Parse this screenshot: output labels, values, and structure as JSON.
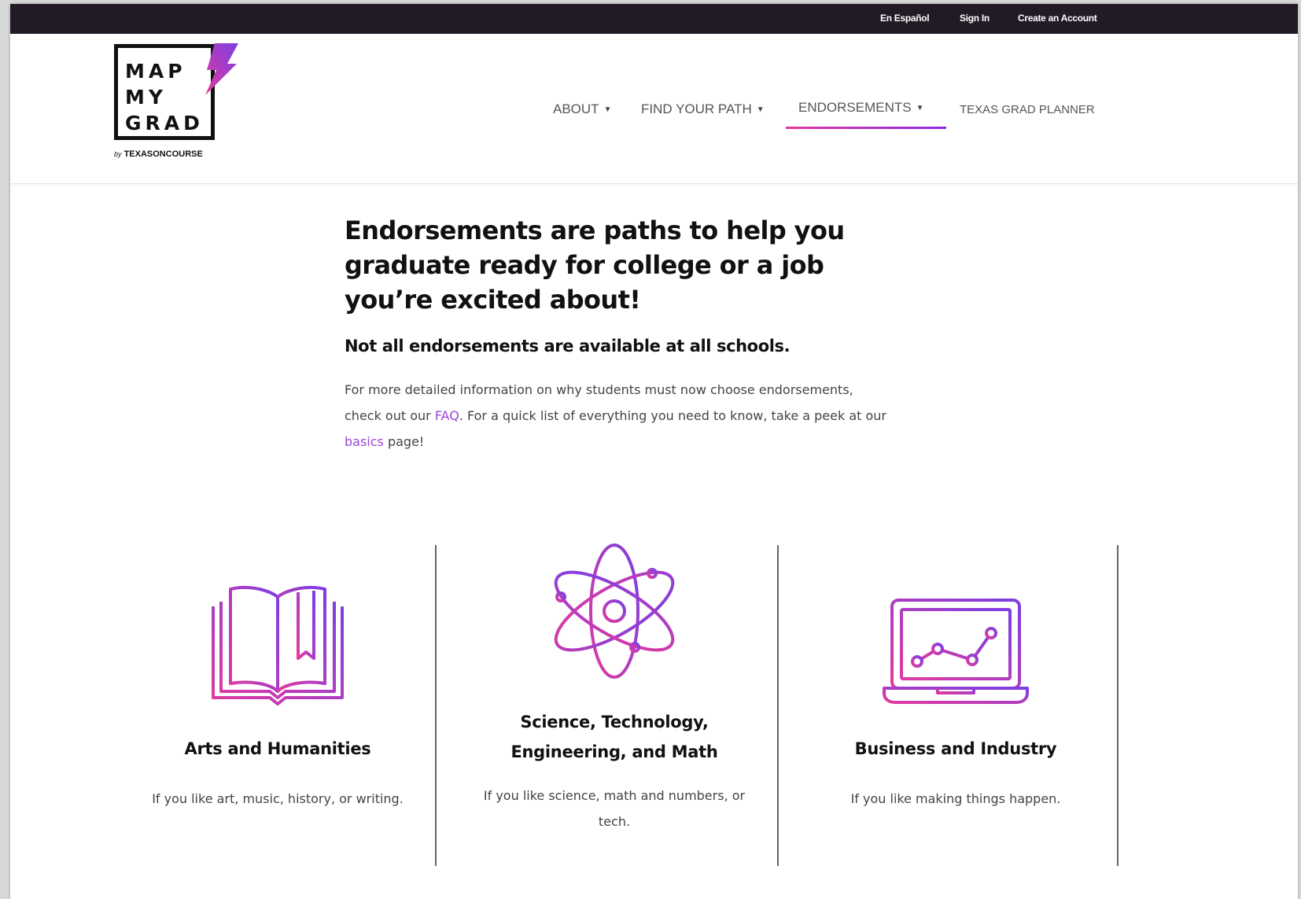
{
  "utility_nav": {
    "espanol": "En Español",
    "sign_in": "Sign In",
    "create_account": "Create an Account"
  },
  "logo": {
    "line1": "MAP",
    "line2": "MY",
    "line3": "GRAD",
    "by": "by",
    "brand": "TEXASONCOURSE"
  },
  "main_nav": {
    "about": "ABOUT",
    "find_your_path": "FIND YOUR PATH",
    "endorsements": "ENDORSEMENTS",
    "grad_planner": "TEXAS GRAD PLANNER",
    "active": "endorsements"
  },
  "intro": {
    "headline": "Endorsements are paths to help you graduate ready for college or a job you’re excited about!",
    "subhead": "Not all endorsements are available at all schools.",
    "text_1": "For more detailed information on why students must now choose endorsements, check out our ",
    "faq_link": "FAQ",
    "text_2": ". For a quick list of everything you need to know, take a peek at our ",
    "basics_link": "basics",
    "text_3": " page!"
  },
  "endorsements": [
    {
      "icon": "book-icon",
      "title": "Arts and Humanities",
      "description": "If you like art, music, history, or writing."
    },
    {
      "icon": "atom-icon",
      "title": "Science, Technology, Engineering, and Math",
      "description": "If you like science, math and numbers, or tech."
    },
    {
      "icon": "laptop-chart-icon",
      "title": "Business and Industry",
      "description": "If you like making things happen."
    }
  ],
  "colors": {
    "topbar": "#221a26",
    "accent_pink": "#e03aa0",
    "accent_purple": "#8a2be2",
    "link": "#9b45d8"
  }
}
